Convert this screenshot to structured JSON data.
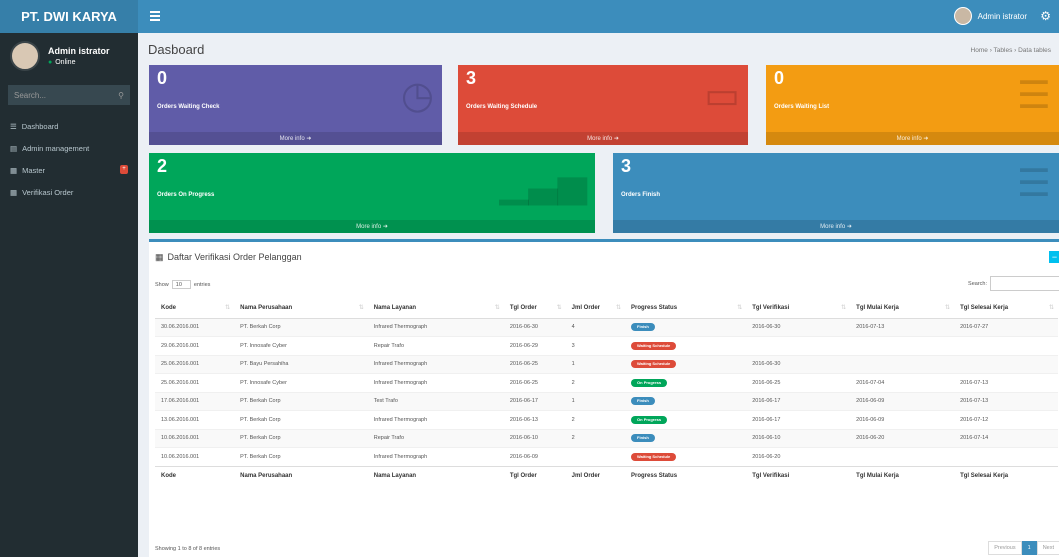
{
  "app": {
    "brand": "PT. DWI KARYA"
  },
  "navbar": {
    "user_name": "Admin istrator"
  },
  "sidebar": {
    "user_name": "Admin istrator",
    "user_status": "Online",
    "search_placeholder": "Search...",
    "items": [
      {
        "label": "Dashboard",
        "icon": "dashboard-icon"
      },
      {
        "label": "Admin management",
        "icon": "users-icon"
      },
      {
        "label": "Master",
        "icon": "archive-icon",
        "badge": "+"
      },
      {
        "label": "Verifikasi Order",
        "icon": "table-icon"
      }
    ]
  },
  "page": {
    "title": "Dasboard",
    "breadcrumb": "Home  ›  Tables  ›  Data tables"
  },
  "info_boxes": [
    {
      "count": "0",
      "label": "Orders Waiting Check",
      "link": "More info",
      "color": "#605ca8",
      "icon": "clock-icon"
    },
    {
      "count": "3",
      "label": "Orders Waiting Schedule",
      "link": "More info",
      "color": "#dd4b39",
      "icon": "calendar-icon"
    },
    {
      "count": "0",
      "label": "Orders Waiting List",
      "link": "More info",
      "color": "#f39c12",
      "icon": "list-icon"
    },
    {
      "count": "2",
      "label": "Orders On Progress",
      "link": "More info",
      "color": "#00a65a",
      "icon": "bar-chart-icon"
    },
    {
      "count": "3",
      "label": "Orders Finish",
      "link": "More info",
      "color": "#3c8dbc",
      "icon": "list-icon"
    }
  ],
  "table_box": {
    "title": "Daftar Verifikasi Order Pelanggan",
    "show_label": "Show",
    "show_value": "10",
    "entries_label": "entries",
    "search_label": "Search:",
    "columns": [
      "Kode",
      "Nama Perusahaan",
      "Nama Layanan",
      "Tgl Order",
      "Jml Order",
      "Progress Status",
      "Tgl Verifikasi",
      "Tgl Mulai Kerja",
      "Tgl Selesai Kerja"
    ],
    "rows": [
      [
        "30.06.2016.001",
        "PT. Berkah Corp",
        "Infrared Thermograph",
        "2016-06-30",
        "4",
        "Finish",
        "2016-06-30",
        "2016-07-13",
        "2016-07-27"
      ],
      [
        "29.06.2016.001",
        "PT. Innosafe Cyber",
        "Repair Trafo",
        "2016-06-29",
        "3",
        "Waiting Schedule",
        "",
        "",
        ""
      ],
      [
        "25.06.2016.001",
        "PT. Bayu Persahiha",
        "Infrared Thermograph",
        "2016-06-25",
        "1",
        "Waiting Schedule",
        "2016-06-30",
        "",
        ""
      ],
      [
        "25.06.2016.001",
        "PT. Innosafe Cyber",
        "Infrared Thermograph",
        "2016-06-25",
        "2",
        "On Progress",
        "2016-06-25",
        "2016-07-04",
        "2016-07-13"
      ],
      [
        "17.06.2016.001",
        "PT. Berkah Corp",
        "Test Trafo",
        "2016-06-17",
        "1",
        "Finish",
        "2016-06-17",
        "2016-06-09",
        "2016-07-13"
      ],
      [
        "13.06.2016.001",
        "PT. Berkah Corp",
        "Infrared Thermograph",
        "2016-06-13",
        "2",
        "On Progress",
        "2016-06-17",
        "2016-06-09",
        "2016-07-12"
      ],
      [
        "10.06.2016.001",
        "PT. Berkah Corp",
        "Repair Trafo",
        "2016-06-10",
        "2",
        "Finish",
        "2016-06-10",
        "2016-06-20",
        "2016-07-14"
      ],
      [
        "10.06.2016.001",
        "PT. Berkah Corp",
        "Infrared Thermograph",
        "2016-06-09",
        "",
        "Waiting Schedule",
        "2016-06-20",
        "",
        ""
      ]
    ],
    "status_colors": {
      "Finish": "#3c8dbc",
      "Waiting Schedule": "#dd4b39",
      "On Progress": "#00a65a"
    },
    "info_text": "Showing 1 to 8 of 8 entries",
    "pagination": {
      "prev": "Previous",
      "current": "1",
      "next": "Next"
    }
  }
}
